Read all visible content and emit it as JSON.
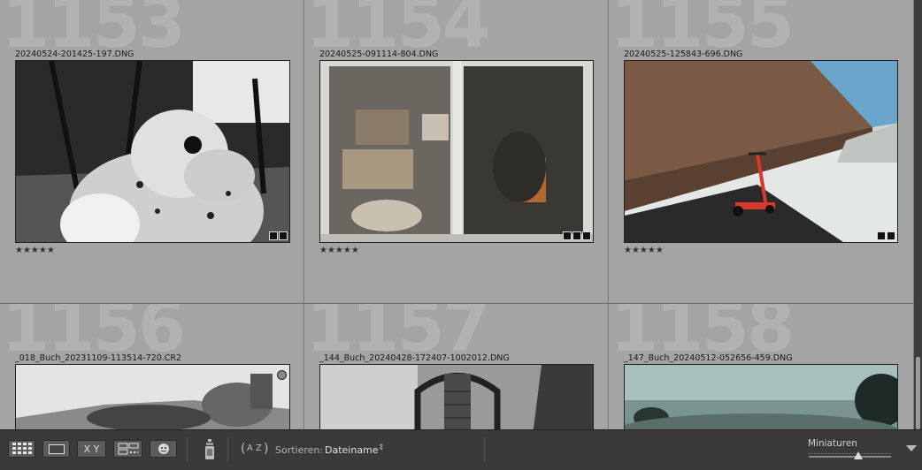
{
  "grid": {
    "cells": [
      {
        "index": "1153",
        "filename": "20240524-201425-197.DNG",
        "stars": "★★★★★"
      },
      {
        "index": "1154",
        "filename": "20240525-091114-804.DNG",
        "stars": "★★★★★"
      },
      {
        "index": "1155",
        "filename": "20240525-125843-696.DNG",
        "stars": "★★★★★"
      },
      {
        "index": "1156",
        "filename": "_018_Buch_20231109-113514-720.CR2",
        "stars": ""
      },
      {
        "index": "1157",
        "filename": "_144_Buch_20240428-172407-1002012.DNG",
        "stars": ""
      },
      {
        "index": "1158",
        "filename": "_147_Buch_20240512-052656-459.DNG",
        "stars": ""
      }
    ]
  },
  "toolbar": {
    "grid_view_icon": "grid-icon",
    "loupe_view_icon": "loupe-icon",
    "compare_label": "X Y",
    "survey_icon": "survey-icon",
    "people_icon": "face-icon",
    "spray_icon": "spray-can-icon",
    "sort_direction_label": "A Z",
    "sort_label": "Sortieren:",
    "sort_value": "Dateiname",
    "thumbnails_label": "Miniaturen",
    "thumbnail_size": 0.6
  }
}
